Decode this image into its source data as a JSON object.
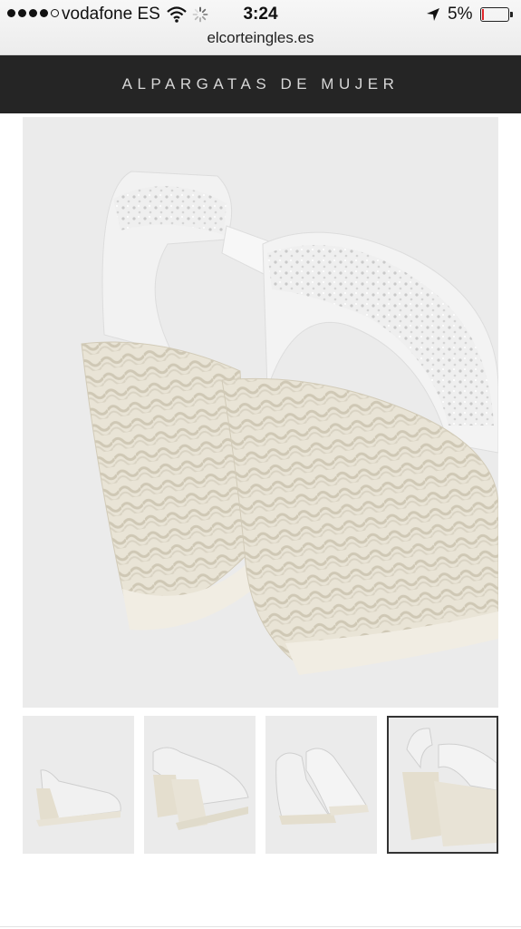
{
  "status_bar": {
    "carrier": "vodafone ES",
    "time": "3:24",
    "battery": "5%",
    "battery_level": 0.05,
    "signal_bars_filled": 4,
    "signal_bars_total": 5
  },
  "address_bar": {
    "url": "elcorteingles.es"
  },
  "header": {
    "title": "ALPARGATAS DE MUJER"
  },
  "gallery": {
    "main_image": "white-espadrille-wedge-sandals-back-view",
    "thumbnails": [
      {
        "image": "espadrille-side-view"
      },
      {
        "image": "espadrille-pair-side-view"
      },
      {
        "image": "espadrille-pair-front-view"
      },
      {
        "image": "espadrille-pair-back-view",
        "selected": true
      }
    ]
  },
  "colors": {
    "header_bg": "#252525",
    "image_bg": "#ebebeb",
    "battery_low": "#e0262b"
  }
}
